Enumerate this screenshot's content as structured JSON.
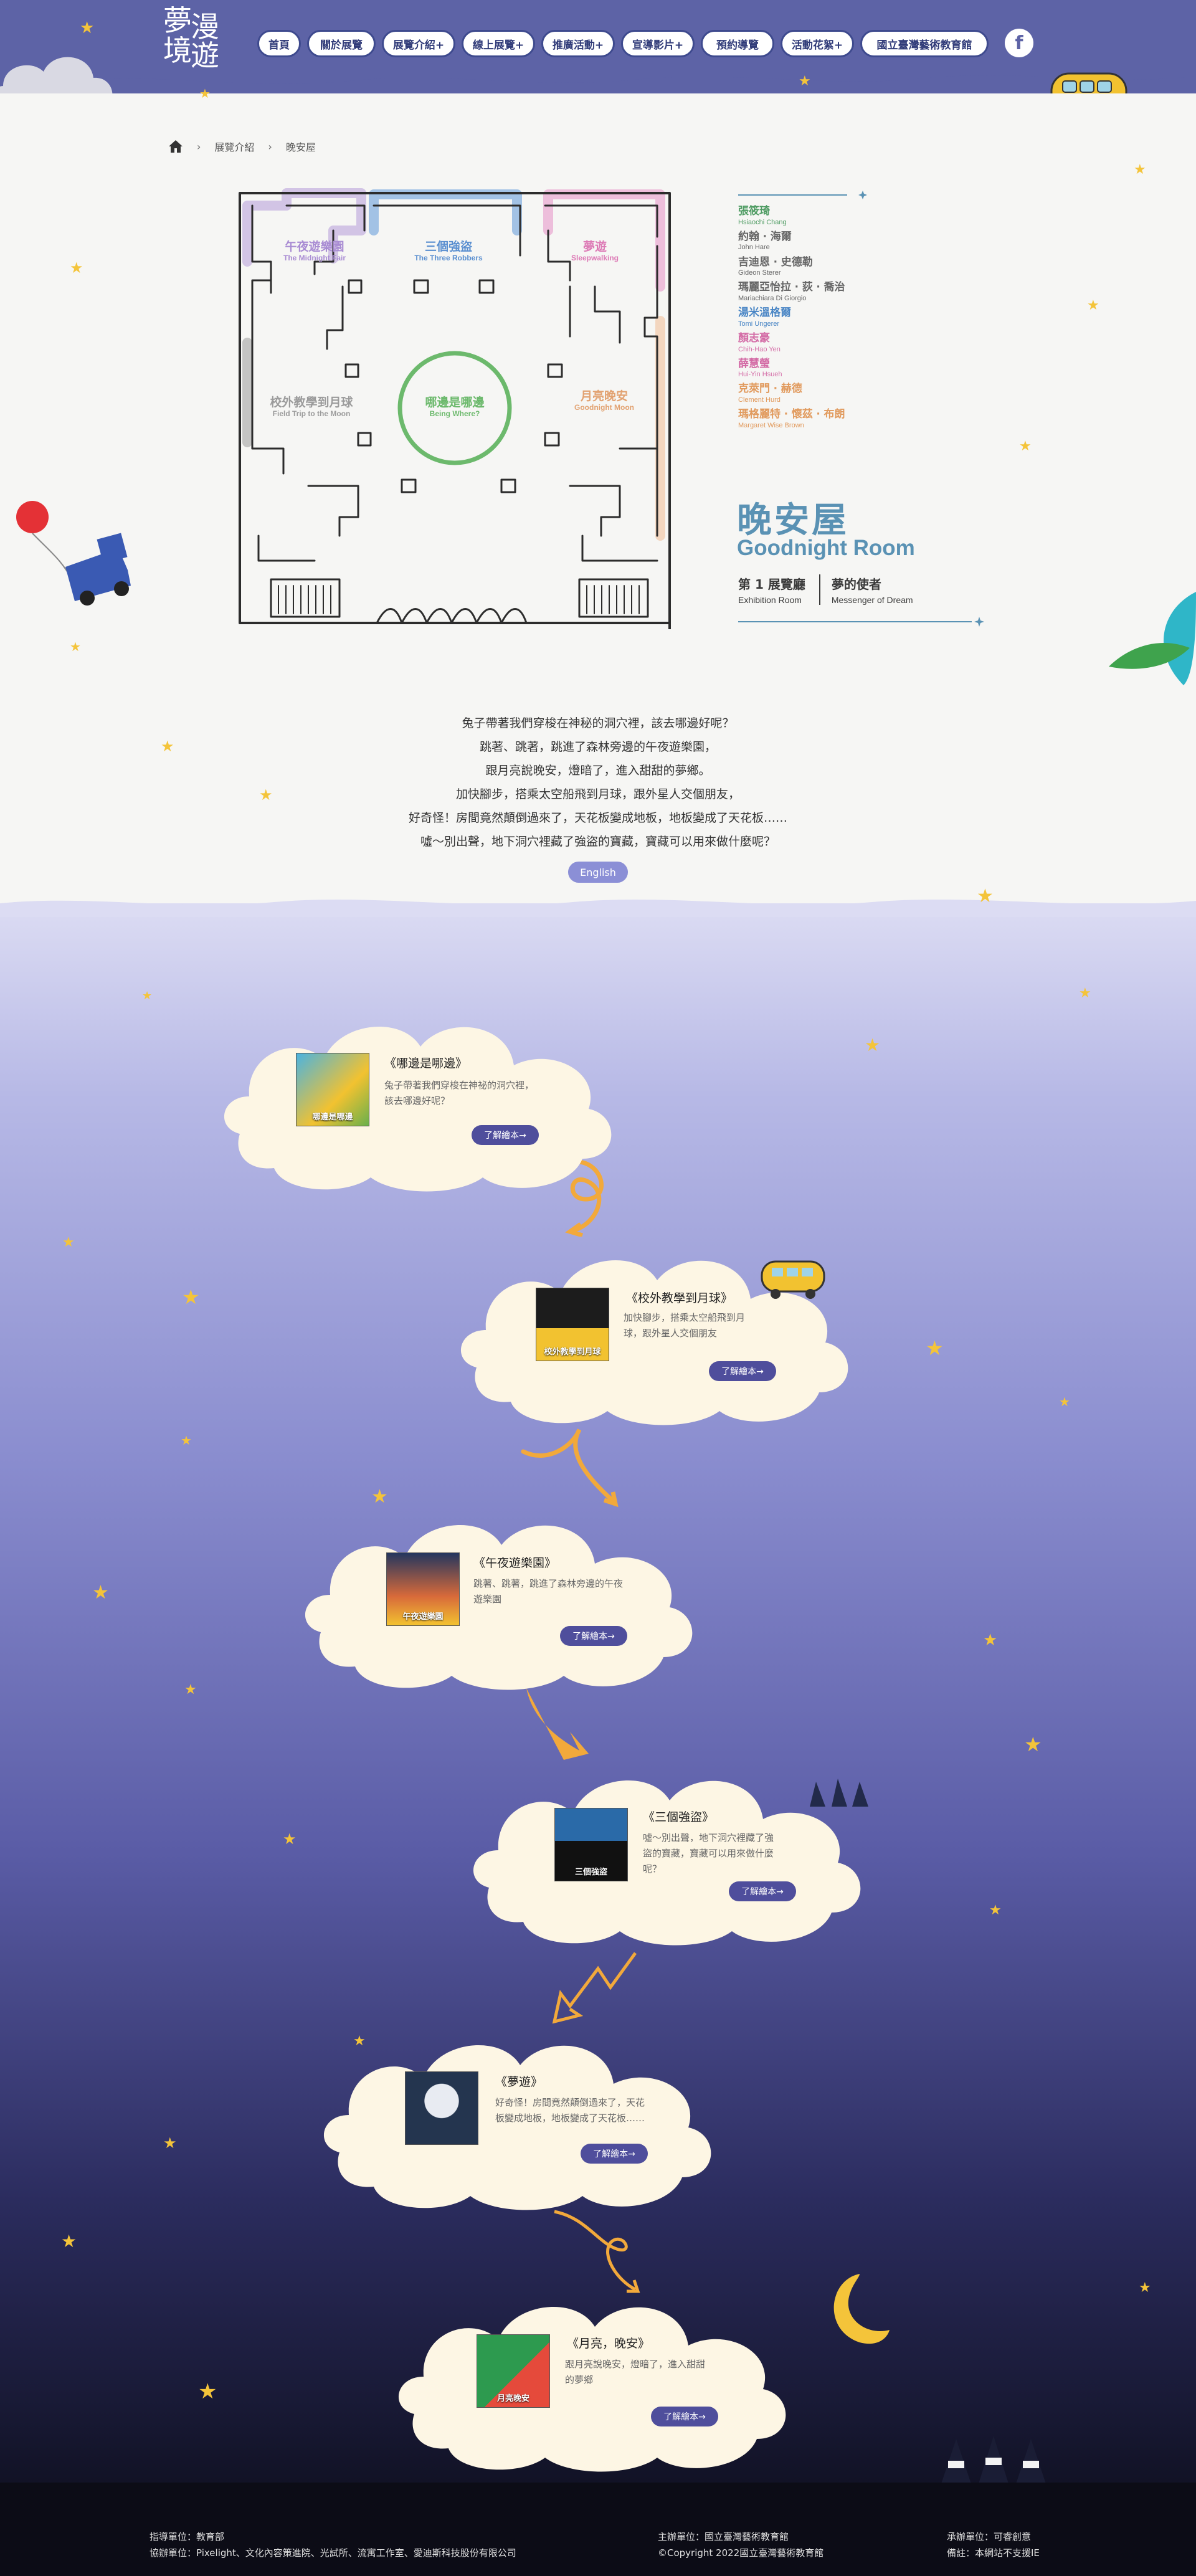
{
  "nav": {
    "logo_text": "夢漫境遊",
    "items": [
      {
        "label": "首頁"
      },
      {
        "label": "關於展覽"
      },
      {
        "label": "展覽介紹+"
      },
      {
        "label": "線上展覽+"
      },
      {
        "label": "推廣活動+"
      },
      {
        "label": "宣導影片+"
      },
      {
        "label": "預約導覽"
      },
      {
        "label": "活動花絮+"
      },
      {
        "label": "國立臺灣藝術教育館"
      }
    ],
    "facebook_icon": "f"
  },
  "breadcrumb": {
    "items": [
      "展覽介紹",
      "晚安屋"
    ],
    "separator": "›"
  },
  "floorplan": {
    "labels": [
      {
        "zh": "午夜遊樂園",
        "en": "The Midnight Fair"
      },
      {
        "zh": "三個強盜",
        "en": "The Three Robbers"
      },
      {
        "zh": "夢遊",
        "en": "Sleepwalking"
      },
      {
        "zh": "校外教學到月球",
        "en": "Field Trip to the Moon"
      },
      {
        "zh": "哪邊是哪邊",
        "en": "Being Where?"
      },
      {
        "zh": "月亮晚安",
        "en": "Goodnight Moon"
      }
    ]
  },
  "artists": [
    {
      "zh": "張筱琦",
      "en": "Hsiaochi Chang",
      "color": "#4f9c63"
    },
    {
      "zh": "約翰 ‧ 海爾",
      "en": "John Hare",
      "color": "#666666"
    },
    {
      "zh": "吉迪恩 ‧ 史德勒",
      "en": "Gideon Sterer",
      "color": "#666666"
    },
    {
      "zh": "瑪麗亞怡拉 ‧ 荻 ‧ 喬治",
      "en": "Mariachiara Di Giorgio",
      "color": "#666666"
    },
    {
      "zh": "湯米溫格爾",
      "en": "Tomi Ungerer",
      "color": "#4a86c5"
    },
    {
      "zh": "顏志豪",
      "en": "Chih-Hao Yen",
      "color": "#d36aa5"
    },
    {
      "zh": "薛慧瑩",
      "en": "Hui-Yin Hsueh",
      "color": "#d36aa5"
    },
    {
      "zh": "克萊門 ‧ 赫德",
      "en": "Clement Hurd",
      "color": "#e19a5d"
    },
    {
      "zh": "瑪格麗特 ‧ 懷茲 ‧ 布朗",
      "en": "Margaret Wise Brown",
      "color": "#e19a5d"
    }
  ],
  "room": {
    "title_zh": "晚安屋",
    "title_en": "Goodnight Room",
    "hall_zh": "第 1 展覽廳",
    "hall_en": "Exhibition Room",
    "role_zh": "夢的使者",
    "role_en": "Messenger of Dream"
  },
  "intro_lines": [
    "兔子帶著我們穿梭在神秘的洞穴裡，該去哪邊好呢？",
    "跳著、跳著，跳進了森林旁邊的午夜遊樂園，",
    "跟月亮說晚安，燈暗了，進入甜甜的夢鄉。",
    "加快腳步，搭乘太空船飛到月球，跟外星人交個朋友，",
    "好奇怪！房間竟然顛倒過來了，天花板變成地板，地板變成了天花板……",
    "噓～別出聲，地下洞穴裡藏了強盜的寶藏，寶藏可以用來做什麼呢？"
  ],
  "english_button": "English",
  "books": [
    {
      "title": "《哪邊是哪邊》",
      "desc": "兔子帶著我們穿梭在神祕的洞穴裡，該去哪邊好呢？",
      "button": "了解繪本→",
      "cover_label": "哪邊是哪邊"
    },
    {
      "title": "《校外教學到月球》",
      "desc": "加快腳步，搭乘太空船飛到月球，跟外星人交個朋友",
      "button": "了解繪本→",
      "cover_label": "校外教學到月球"
    },
    {
      "title": "《午夜遊樂園》",
      "desc": "跳著、跳著，跳進了森林旁邊的午夜遊樂園",
      "button": "了解繪本→",
      "cover_label": "午夜遊樂園"
    },
    {
      "title": "《三個強盜》",
      "desc": "噓～別出聲，地下洞穴裡藏了強盜的寶藏，寶藏可以用來做什麼呢？",
      "button": "了解繪本→",
      "cover_label": "三個強盜"
    },
    {
      "title": "《夢遊》",
      "desc": "好奇怪！房間竟然顛倒過來了，天花板變成地板，地板變成了天花板……",
      "button": "了解繪本→",
      "cover_label": ""
    },
    {
      "title": "《月亮，晚安》",
      "desc": "跟月亮說晚安，燈暗了，進入甜甜的夢鄉",
      "button": "了解繪本→",
      "cover_label": "月亮晚安"
    }
  ],
  "footer": {
    "guide": "指導單位：教育部",
    "assist": "協辦單位：Pixelight、文化內容策進院、光試所、流寓工作室、愛迪斯科技股份有限公司",
    "host": "主辦單位：國立臺灣藝術教育館",
    "copyright": "©Copyright 2022國立臺灣藝術教育館",
    "contractor": "承辦單位：可睿創意",
    "note": "備註：本網站不支援IE"
  }
}
